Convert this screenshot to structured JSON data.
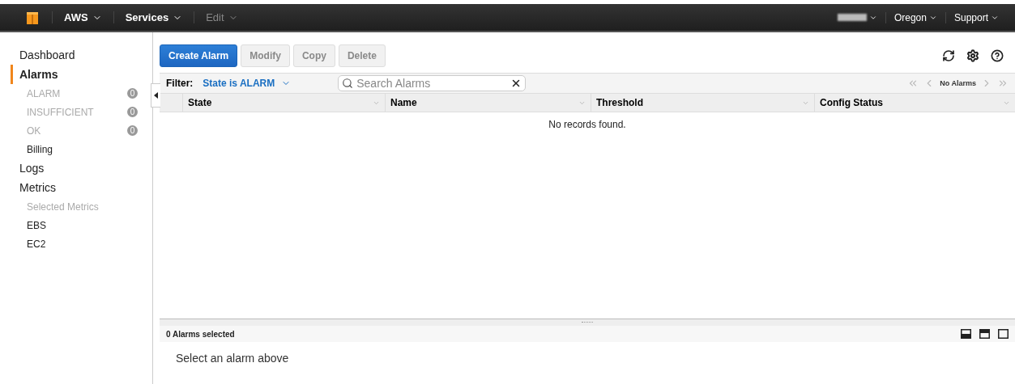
{
  "topbar": {
    "menus": [
      {
        "label": "AWS",
        "disabled": false
      },
      {
        "label": "Services",
        "disabled": false
      },
      {
        "label": "Edit",
        "disabled": true
      }
    ],
    "right_menus": [
      {
        "label": "Oregon"
      },
      {
        "label": "Support"
      }
    ]
  },
  "sidebar": {
    "items": [
      {
        "label": "Dashboard",
        "kind": "section",
        "selected": false,
        "disabled": false
      },
      {
        "label": "Alarms",
        "kind": "section",
        "selected": true,
        "disabled": false
      },
      {
        "label": "ALARM",
        "kind": "sub",
        "selected": false,
        "disabled": true,
        "count": "0"
      },
      {
        "label": "INSUFFICIENT",
        "kind": "sub",
        "selected": false,
        "disabled": true,
        "count": "0"
      },
      {
        "label": "OK",
        "kind": "sub",
        "selected": false,
        "disabled": true,
        "count": "0"
      },
      {
        "label": "Billing",
        "kind": "sub",
        "selected": false,
        "disabled": false
      },
      {
        "label": "Logs",
        "kind": "section",
        "selected": false,
        "disabled": false
      },
      {
        "label": "Metrics",
        "kind": "section",
        "selected": false,
        "disabled": false
      },
      {
        "label": "Selected Metrics",
        "kind": "sub",
        "selected": false,
        "disabled": true
      },
      {
        "label": "EBS",
        "kind": "sub",
        "selected": false,
        "disabled": false
      },
      {
        "label": "EC2",
        "kind": "sub",
        "selected": false,
        "disabled": false
      }
    ]
  },
  "toolbar": {
    "buttons": [
      {
        "label": "Create Alarm",
        "kind": "primary",
        "disabled": false
      },
      {
        "label": "Modify",
        "kind": "plain",
        "disabled": true
      },
      {
        "label": "Copy",
        "kind": "plain",
        "disabled": true
      },
      {
        "label": "Delete",
        "kind": "plain",
        "disabled": true
      }
    ]
  },
  "filter": {
    "label": "Filter:",
    "value": "State is ALARM",
    "search": {
      "placeholder": "Search Alarms"
    },
    "pager": "No Alarms"
  },
  "table": {
    "columns": [
      "State",
      "Name",
      "Threshold",
      "Config Status"
    ],
    "empty_message": "No records found."
  },
  "details": {
    "title": "0 Alarms selected",
    "message": "Select an alarm above"
  }
}
